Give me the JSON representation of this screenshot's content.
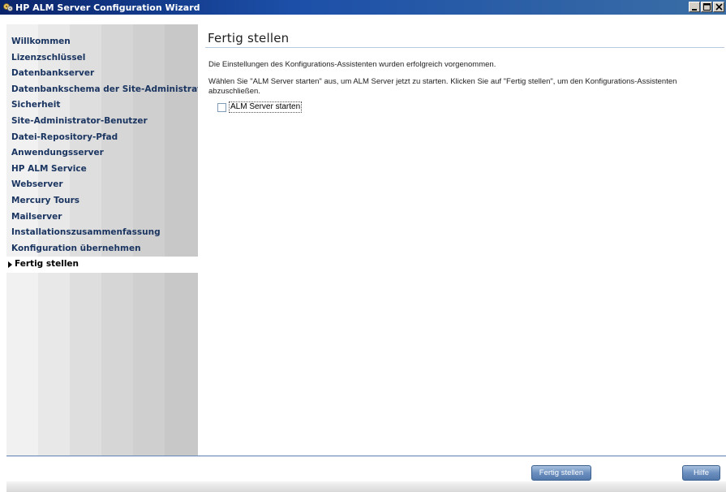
{
  "window": {
    "title": "HP ALM Server Configuration Wizard",
    "controls": [
      "minimize",
      "maximize",
      "close"
    ]
  },
  "sidebar": {
    "items": [
      {
        "label": "Willkommen",
        "active": false
      },
      {
        "label": "Lizenzschlüssel",
        "active": false
      },
      {
        "label": "Datenbankserver",
        "active": false
      },
      {
        "label": "Datenbankschema der Site-Administration",
        "active": false
      },
      {
        "label": "Sicherheit",
        "active": false
      },
      {
        "label": "Site-Administrator-Benutzer",
        "active": false
      },
      {
        "label": "Datei-Repository-Pfad",
        "active": false
      },
      {
        "label": "Anwendungsserver",
        "active": false
      },
      {
        "label": "HP ALM Service",
        "active": false
      },
      {
        "label": "Webserver",
        "active": false
      },
      {
        "label": "Mercury Tours",
        "active": false
      },
      {
        "label": "Mailserver",
        "active": false
      },
      {
        "label": "Installationszusammenfassung",
        "active": false
      },
      {
        "label": "Konfiguration übernehmen",
        "active": false
      },
      {
        "label": "Fertig stellen",
        "active": true
      }
    ]
  },
  "main": {
    "title": "Fertig stellen",
    "message1": "Die Einstellungen des Konfigurations-Assistenten wurden erfolgreich vorgenommen.",
    "message2": "Wählen Sie \"ALM Server starten\" aus, um ALM Server jetzt zu starten. Klicken Sie auf \"Fertig stellen\", um den Konfigurations-Assistenten abzuschließen.",
    "checkbox": {
      "label": "ALM Server starten",
      "checked": false
    }
  },
  "footer": {
    "finish_label": "Fertig stellen",
    "help_label": "Hilfe"
  },
  "colors": {
    "titlebar": "#0a246a",
    "sidebar_text": "#1b3561",
    "button": "#6b8fbf"
  }
}
